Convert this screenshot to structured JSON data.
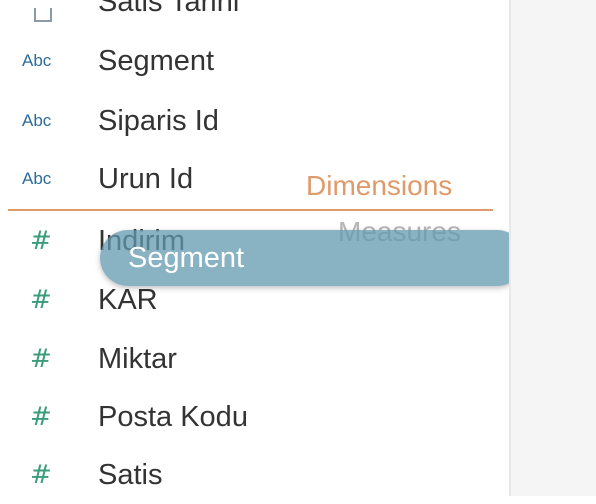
{
  "data_pane": {
    "partial_field": {
      "type_icon": "calendar-icon",
      "name": "Satis Tarihi"
    },
    "dimensions": [
      {
        "type_label": "Abc",
        "name": "Segment"
      },
      {
        "type_label": "Abc",
        "name": "Siparis Id"
      },
      {
        "type_label": "Abc",
        "name": "Urun Id"
      }
    ],
    "measures": [
      {
        "type_label": "#",
        "name": "Indirim"
      },
      {
        "type_label": "#",
        "name": "KAR"
      },
      {
        "type_label": "#",
        "name": "Miktar"
      },
      {
        "type_label": "#",
        "name": "Posta Kodu"
      },
      {
        "type_label": "#",
        "name": "Satis"
      }
    ],
    "dimensions_label": "Dimensions",
    "measures_label": "Measures"
  },
  "drag": {
    "pill_label": "Segment"
  },
  "colors": {
    "dimension_blue": "#2b6c9a",
    "measure_green": "#3a9c7a",
    "section_orange": "#e09a6a",
    "pill_blue": "#6298af"
  }
}
